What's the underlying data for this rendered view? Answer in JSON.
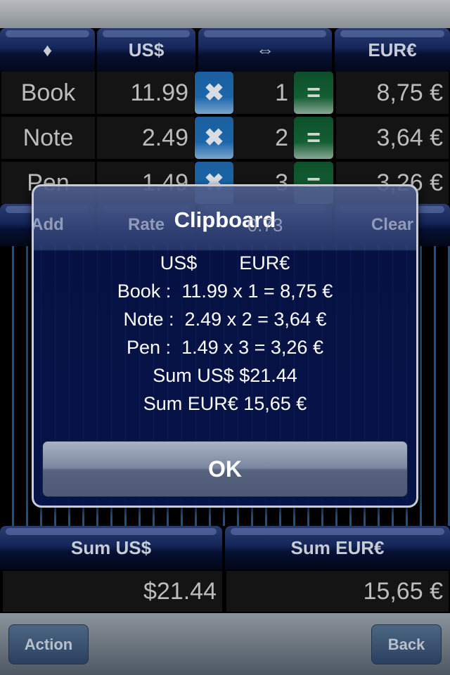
{
  "header": {
    "col1": "♦",
    "col2": "US$",
    "col3": "⇔",
    "col4": "EUR€"
  },
  "rows": [
    {
      "item": "Book",
      "usd": "11.99",
      "multiply": "✖",
      "qty": "1",
      "equals": "=",
      "eur": "8,75 €"
    },
    {
      "item": "Note",
      "usd": "2.49",
      "multiply": "✖",
      "qty": "2",
      "equals": "=",
      "eur": "3,64 €"
    },
    {
      "item": "Pen",
      "usd": "1.49",
      "multiply": "✖",
      "qty": "3",
      "equals": "=",
      "eur": "3,26 €"
    }
  ],
  "actions": {
    "add": "Add",
    "rate": "Rate",
    "rate_value": "0.73",
    "clear": "Clear"
  },
  "sums": {
    "usd_label": "Sum US$",
    "eur_label": "Sum EUR€",
    "usd_value": "$21.44",
    "eur_value": "15,65 €"
  },
  "toolbar": {
    "action": "Action",
    "back": "Back"
  },
  "dialog": {
    "title": "Clipboard",
    "lines": [
      "US$        EUR€",
      "Book :  11.99 x 1 = 8,75 €",
      "Note :  2.49 x 2 = 3,64 €",
      "Pen :  1.49 x 3 = 3,26 €",
      "Sum US$ $21.44",
      "Sum EUR€ 15,65 €"
    ],
    "ok": "OK"
  }
}
